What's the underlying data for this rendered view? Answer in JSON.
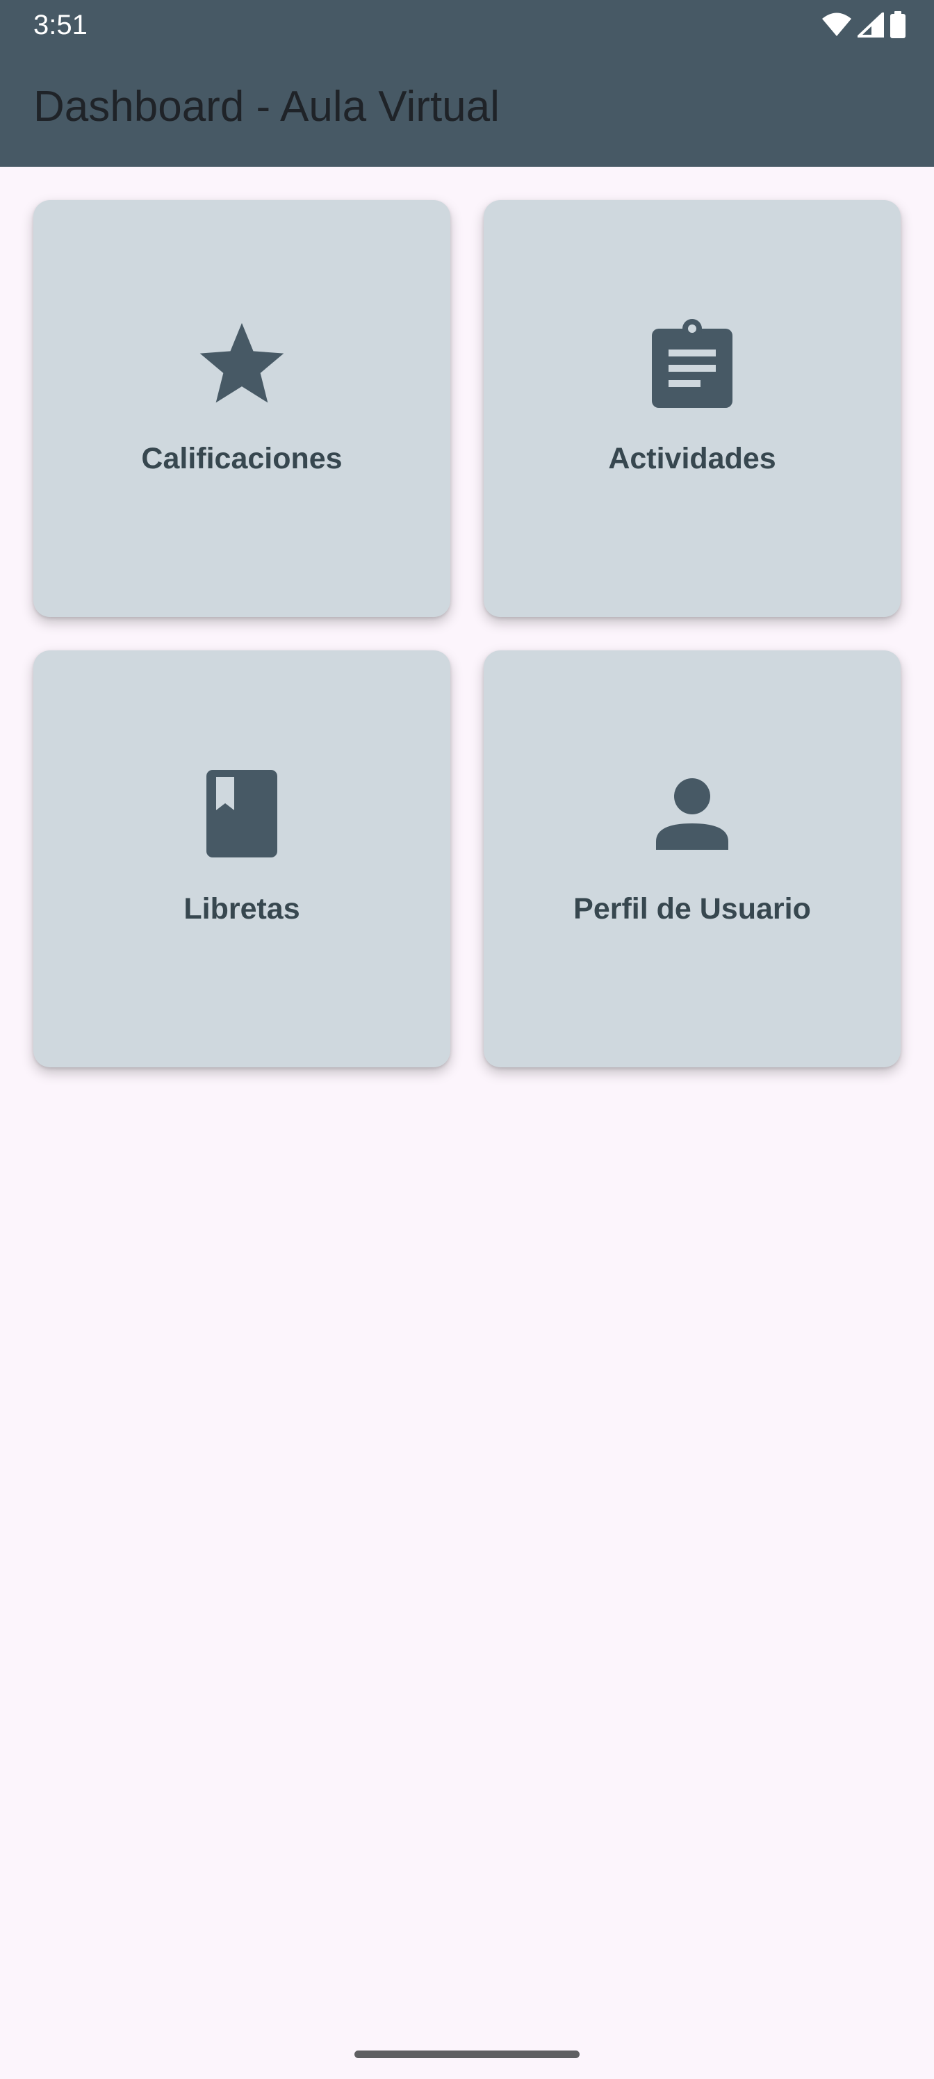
{
  "status_bar": {
    "time": "3:51",
    "icons": [
      "wifi-icon",
      "signal-icon",
      "battery-icon"
    ]
  },
  "app_bar": {
    "title": "Dashboard - Aula Virtual"
  },
  "cards": [
    {
      "label": "Calificaciones",
      "icon": "star-icon"
    },
    {
      "label": "Actividades",
      "icon": "clipboard-icon"
    },
    {
      "label": "Libretas",
      "icon": "book-icon"
    },
    {
      "label": "Perfil de Usuario",
      "icon": "person-icon"
    }
  ],
  "colors": {
    "app_bar": "#475965",
    "background": "#fcf5fc",
    "card": "#cfd8de",
    "icon": "#475965",
    "label": "#37474f"
  }
}
